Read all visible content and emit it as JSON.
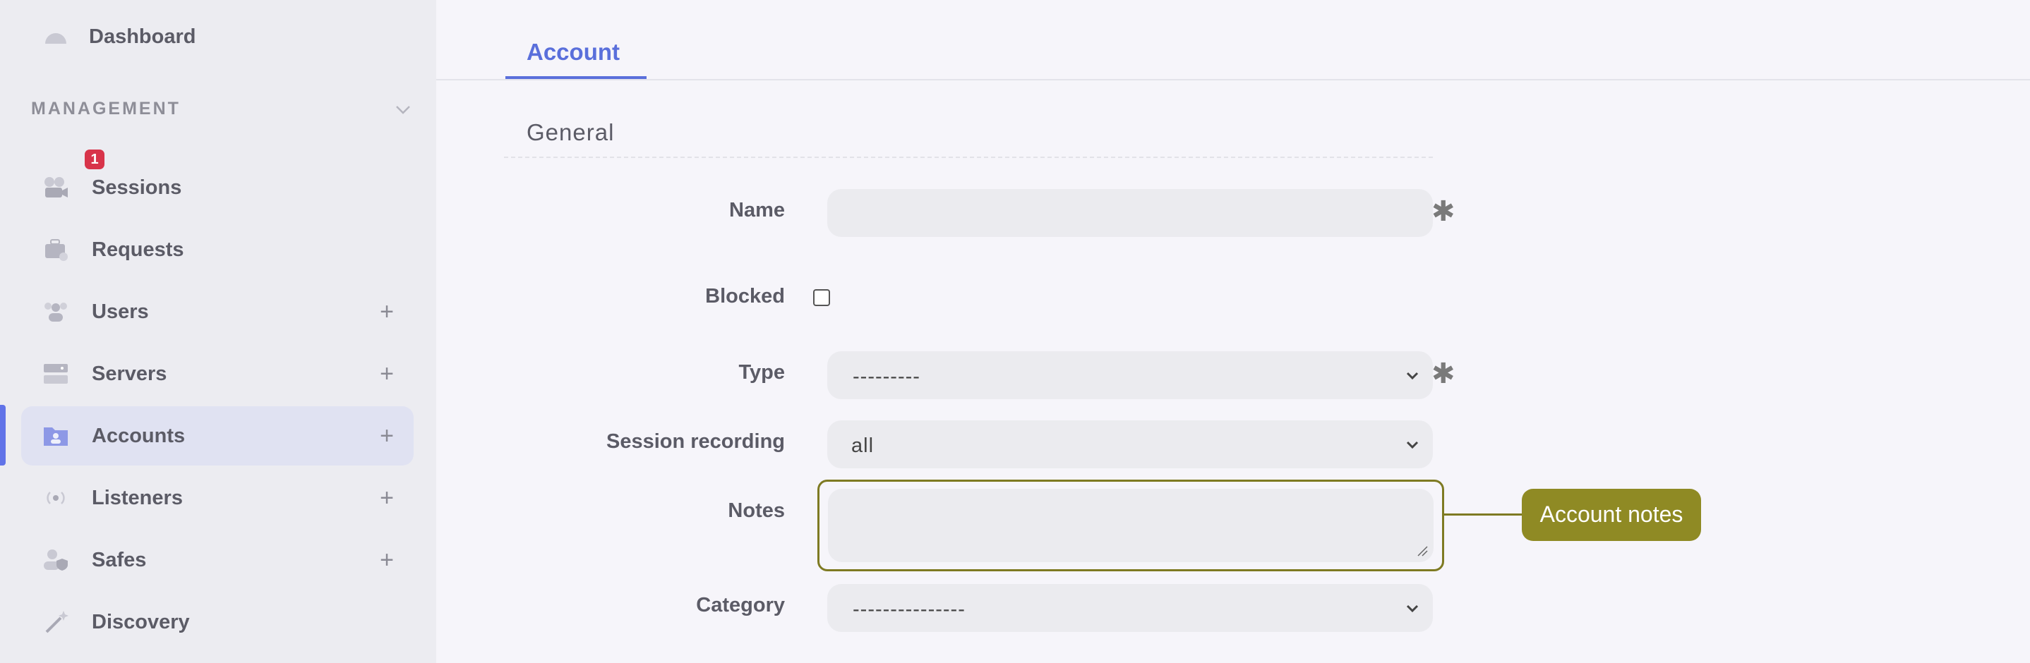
{
  "sidebar": {
    "dashboard": "Dashboard",
    "section": "MANAGEMENT",
    "items": [
      {
        "label": "Sessions",
        "badge": "1"
      },
      {
        "label": "Requests"
      },
      {
        "label": "Users",
        "plus": "+"
      },
      {
        "label": "Servers",
        "plus": "+"
      },
      {
        "label": "Accounts",
        "plus": "+"
      },
      {
        "label": "Listeners",
        "plus": "+"
      },
      {
        "label": "Safes",
        "plus": "+"
      },
      {
        "label": "Discovery"
      }
    ]
  },
  "tabs": {
    "active": "Account"
  },
  "form": {
    "section_title": "General",
    "name_label": "Name",
    "blocked_label": "Blocked",
    "type_label": "Type",
    "type_value": "---------",
    "session_recording_label": "Session recording",
    "session_recording_value": "all",
    "notes_label": "Notes",
    "category_label": "Category",
    "category_value": "---------------",
    "required_mark": "✱"
  },
  "callout": {
    "text": "Account notes"
  },
  "colors": {
    "accent": "#5a6fdb",
    "badge": "#d8344a",
    "callout": "#8f8a24",
    "highlight_border": "#7e7a22"
  }
}
